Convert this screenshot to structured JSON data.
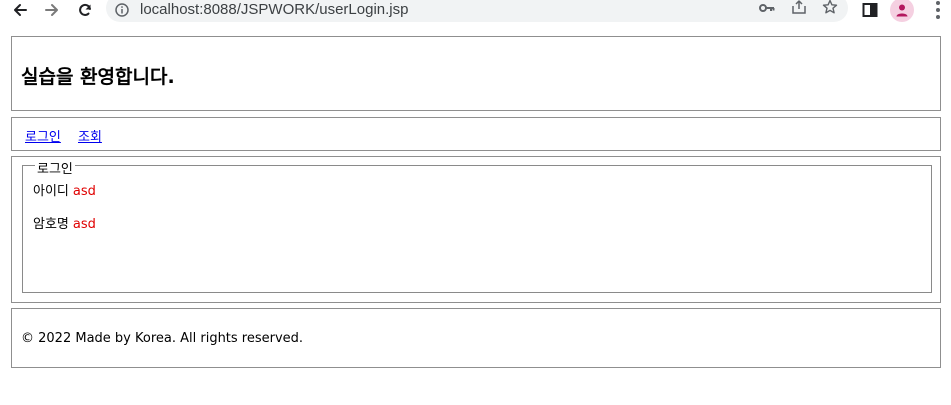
{
  "browser": {
    "url": "localhost:8088/JSPWORK/userLogin.jsp",
    "icons": {
      "back": "arrow-left-icon",
      "forward": "arrow-right-icon",
      "reload": "reload-icon",
      "site_info": "info-circle-icon",
      "password": "key-icon",
      "share": "share-icon",
      "bookmark": "star-icon",
      "side_panel": "side-panel-icon",
      "profile": "profile-avatar-icon",
      "menu": "more-vert-icon"
    },
    "colors": {
      "omnibox_bg": "#f1f3f4",
      "profile_accent": "#b3185e"
    }
  },
  "header": {
    "title": "실습을 환영합니다."
  },
  "nav": {
    "links": [
      {
        "label": "로그인"
      },
      {
        "label": "조회"
      }
    ]
  },
  "login": {
    "legend": "로그인",
    "fields": [
      {
        "label": "아이디",
        "value": "asd"
      },
      {
        "label": "암호명",
        "value": "asd"
      }
    ],
    "value_color": "#e00000"
  },
  "footer": {
    "text": "© 2022 Made by Korea. All rights reserved."
  }
}
